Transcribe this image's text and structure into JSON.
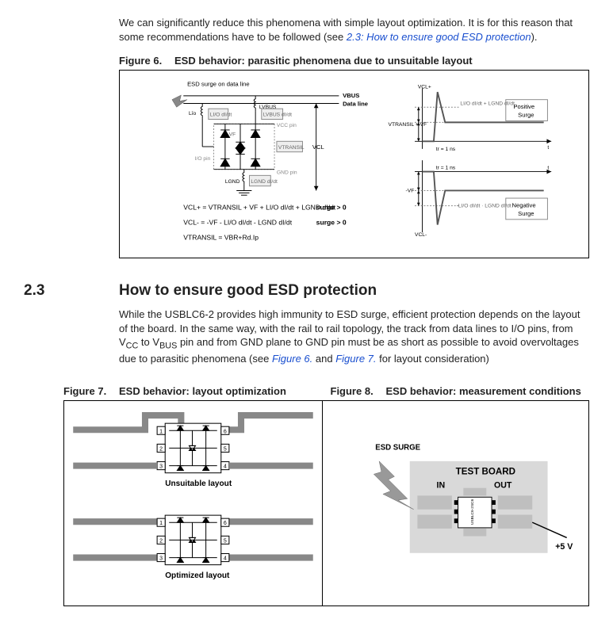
{
  "intro": {
    "p1a": "We can significantly reduce this phenomena with simple layout optimization. It is for this reason that some recommendations have to be followed (see ",
    "p1link": "2.3: How to ensure good ESD protection",
    "p1b": ")."
  },
  "fig6": {
    "caption_num": "Figure 6.",
    "caption_text": "ESD behavior: parasitic phenomena due to unsuitable layout",
    "labels": {
      "esd_surge": "ESD surge on data line",
      "vbus": "VBUS",
      "data_line": "Data line",
      "lio": "Līo",
      "lvbus": "LVBUS",
      "lio_didt": "LI/O dI/dt",
      "lvbus_didt": "LVBUS dI/dt",
      "vcc_pin": "VCC pin",
      "vf": "VF",
      "vtransil": "VTRANSIL",
      "vcl": "VCL",
      "io_pin": "I/O pin",
      "gnd_pin": "GND pin",
      "lgnd": "LGND",
      "lgnd_didt": "LGND dI/dt",
      "eq1": "VCL+ = VTRANSIL + VF + LI/O dI/dt + LGND dI/dt",
      "eq2": "VCL- = -VF - LI/O dI/dt - LGND dI/dt",
      "eq3": "VTRANSIL = VBR+Rd.Ip",
      "surge_pos": "surge > 0",
      "surge_neg": "surge > 0",
      "vcl_plus": "VCL+",
      "vcl_minus": "VCL-",
      "pos_surge": "Positive\nSurge",
      "neg_surge": "Negative\nSurge",
      "y1": "LI/O dI/dt + LGND dI/dt",
      "y2": "VTRANSIL + VF",
      "y3": "-VF",
      "y4": "-LI/O dI/dt · LGND dI/dt",
      "tr": "tr = 1 ns",
      "t": "t"
    }
  },
  "section23": {
    "num": "2.3",
    "title": "How to ensure good ESD protection",
    "p1a": "While the USBLC6-2 provides high immunity to ESD surge, efficient protection depends on the layout of the board. In the same way, with the rail to rail topology, the track from data lines to I/O pins, from V",
    "p1sub1": "CC",
    "p1b": " to V",
    "p1sub2": "BUS",
    "p1c": " pin and from GND plane to GND pin must be as short as possible to avoid overvoltages due to parasitic phenomena (see ",
    "link1": "Figure 6.",
    "p1d": " and ",
    "link2": "Figure 7.",
    "p1e": " for layout consideration)"
  },
  "fig7": {
    "caption_num": "Figure 7.",
    "caption_text": "ESD behavior: layout optimization",
    "unsuitable": "Unsuitable layout",
    "optimized": "Optimized layout"
  },
  "fig8": {
    "caption_num": "Figure 8.",
    "caption_text": "ESD behavior: measurement conditions",
    "esd_surge": "ESD SURGE",
    "test_board": "TEST BOARD",
    "in": "IN",
    "out": "OUT",
    "v5": "+5 V",
    "chip": "USBLC6-2SC6"
  }
}
